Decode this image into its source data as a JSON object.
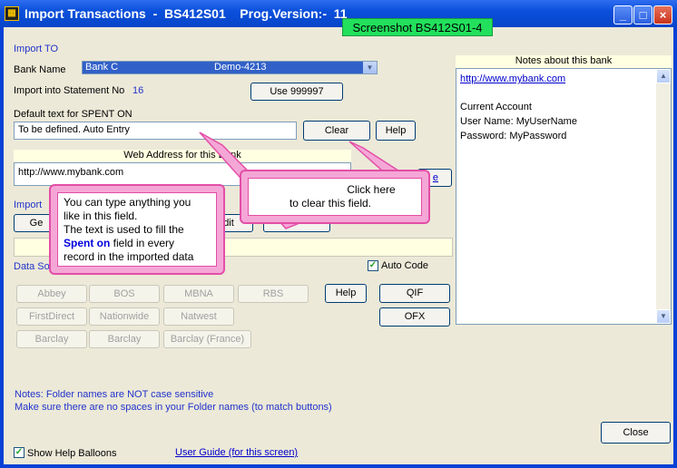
{
  "window": {
    "title": "Import Transactions  -  BS412S01    Prog.Version:-  11",
    "screenshot_tag": "Screenshot BS412S01-4",
    "minimize": "_",
    "maximize": "□",
    "close": "×"
  },
  "import_to": {
    "heading": "Import TO",
    "bank_label": "Bank Name",
    "bank_value": "Bank C",
    "bank_account": "Demo-4213",
    "statement_label": "Import into Statement No",
    "statement_no": "16",
    "use_button": "Use 999997"
  },
  "spent_on": {
    "label": "Default text for SPENT ON",
    "value": "To be defined. Auto Entry",
    "clear_button": "Clear",
    "help_button": "Help"
  },
  "web": {
    "header": "Web Address for this Bank",
    "value": "http://www.mybank.com",
    "go_button_fragment": "e",
    "import_label_fragment": "Import",
    "ge_fragment": "Ge",
    "edit_fragment": "dit",
    "data_source_fragment": "Data So"
  },
  "data_source": {
    "auto_code_label": "Auto Code",
    "auto_code_checked": "✓",
    "help_button": "Help",
    "qif_button": "QIF",
    "ofx_button": "OFX",
    "banks": [
      [
        "Abbey",
        "BOS",
        "MBNA",
        "RBS"
      ],
      [
        "FirstDirect",
        "Nationwide",
        "Natwest"
      ],
      [
        "Barclay",
        "Barclay",
        "Barclay (France)"
      ]
    ]
  },
  "notes": {
    "header": "Notes about this bank",
    "link": "http://www.mybank.com",
    "lines": [
      "Current Account",
      "User Name: MyUserName",
      "Password:  MyPassword"
    ]
  },
  "footer": {
    "note1": "Notes: Folder names are NOT case sensitive",
    "note2": "Make sure there are no spaces in your Folder names (to match buttons)",
    "close_button": "Close",
    "show_help_label": "Show Help Balloons",
    "show_help_checked": "✓",
    "user_guide": "User Guide (for this screen)"
  },
  "balloons": {
    "left_line1": "You can type anything you",
    "left_line2": "like in this field.",
    "left_line3": "The text is used to fill the",
    "left_highlight": "Spent on",
    "left_line4_rest": " field in every",
    "left_line5": "record in the imported data",
    "right_line1": "Click here",
    "right_line2": "to clear this field."
  },
  "colors": {
    "balloon_border": "#e34ea7",
    "link": "#0000cc",
    "label_blue": "#2233cc"
  }
}
